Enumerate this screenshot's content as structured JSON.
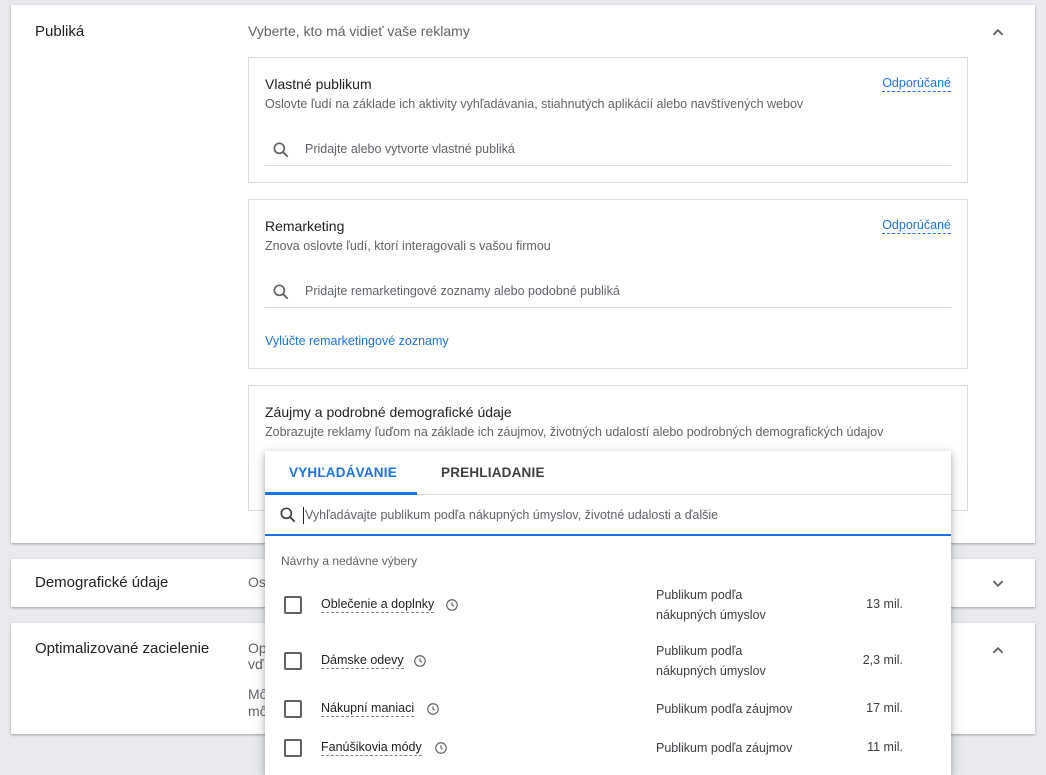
{
  "audiences": {
    "title": "Publiká",
    "subtitle": "Vyberte, kto má vidieť vaše reklamy",
    "custom": {
      "title": "Vlastné publikum",
      "desc": "Oslovte ľudí na základe ich aktivity vyhľadávania, stiahnutých aplikácií alebo navštívených webov",
      "link": "Odporúčané",
      "placeholder": "Pridajte alebo vytvorte vlastné publiká"
    },
    "remarketing": {
      "title": "Remarketing",
      "desc": "Znova oslovte ľudí, ktorí interagovali s vašou firmou",
      "link": "Odporúčané",
      "placeholder": "Pridajte remarketingové zoznamy alebo podobné publiká",
      "exclude": "Vylúčte remarketingové zoznamy"
    },
    "interests": {
      "title": "Záujmy a podrobné demografické údaje",
      "desc": "Zobrazujte reklamy ľuďom na základe ich záujmov, životných udalostí alebo podrobných demografických údajov"
    }
  },
  "demographics": {
    "title": "Demografické údaje",
    "sub": "Os"
  },
  "optimized": {
    "title": "Optimalizované zacielenie",
    "sub1": "Op",
    "sub2": "vď",
    "sub3": "Mô",
    "sub4": "mô"
  },
  "dropdown": {
    "tab_search": "VYHĽADÁVANIE",
    "tab_browse": "PREHLIADANIE",
    "placeholder": "Vyhľadávajte publikum podľa nákupných úmyslov, životné udalosti a ďalšie",
    "section": "Návrhy a nedávne výbery",
    "items": [
      {
        "name": "Oblečenie a doplnky",
        "type1": "Publikum podľa",
        "type2": "nákupných úmyslov",
        "size": "13 mil."
      },
      {
        "name": "Dámske odevy",
        "type1": "Publikum podľa",
        "type2": "nákupných úmyslov",
        "size": "2,3 mil."
      },
      {
        "name": "Nákupní maniaci",
        "type1": "Publikum podľa záujmov",
        "type2": "",
        "size": "17 mil."
      },
      {
        "name": "Fanúšikovia módy",
        "type1": "Publikum podľa záujmov",
        "type2": "",
        "size": "11 mil."
      }
    ]
  },
  "colors": {
    "accent": "#1a73e8",
    "text": "#202124",
    "muted": "#5f6368"
  }
}
